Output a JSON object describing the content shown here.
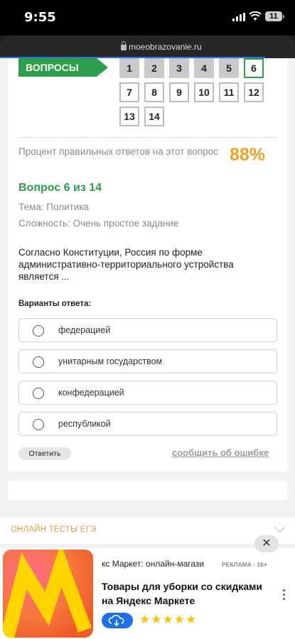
{
  "status_bar": {
    "time": "9:55",
    "battery": "11"
  },
  "browser": {
    "url": "moeobrazovanie.ru"
  },
  "navigator": {
    "label": "ВОПРОСЫ",
    "questions": [
      "1",
      "2",
      "3",
      "4",
      "5",
      "6",
      "7",
      "8",
      "9",
      "10",
      "11",
      "12",
      "13",
      "14"
    ],
    "current": "6"
  },
  "stats": {
    "label": "Процент правильных ответов на этот вопрос",
    "value": "88%"
  },
  "question": {
    "title": "Вопрос 6 из 14",
    "topic": "Тема: Политика",
    "difficulty": "Сложность: Очень простое задание",
    "text": "Согласно Конституции, Россия по форме административно-территориального устройства является ..."
  },
  "answers": {
    "heading": "Варианты ответа:",
    "options": [
      "федерацией",
      "унитарным государством",
      "конфедерацией",
      "республикой"
    ]
  },
  "actions": {
    "answer": "Ответить",
    "report": "сообщить об ошибке"
  },
  "tests_section": {
    "label": "ОНЛАЙН ТЕСТЫ ЕГЭ"
  },
  "ad": {
    "close": "✕",
    "source": "кс Маркет: онлайн-магази",
    "tag": "РЕКЛАМА · 16+",
    "headline": "Товары для уборки со скидками на Яндекс Маркете",
    "rating": "★★★★★"
  }
}
